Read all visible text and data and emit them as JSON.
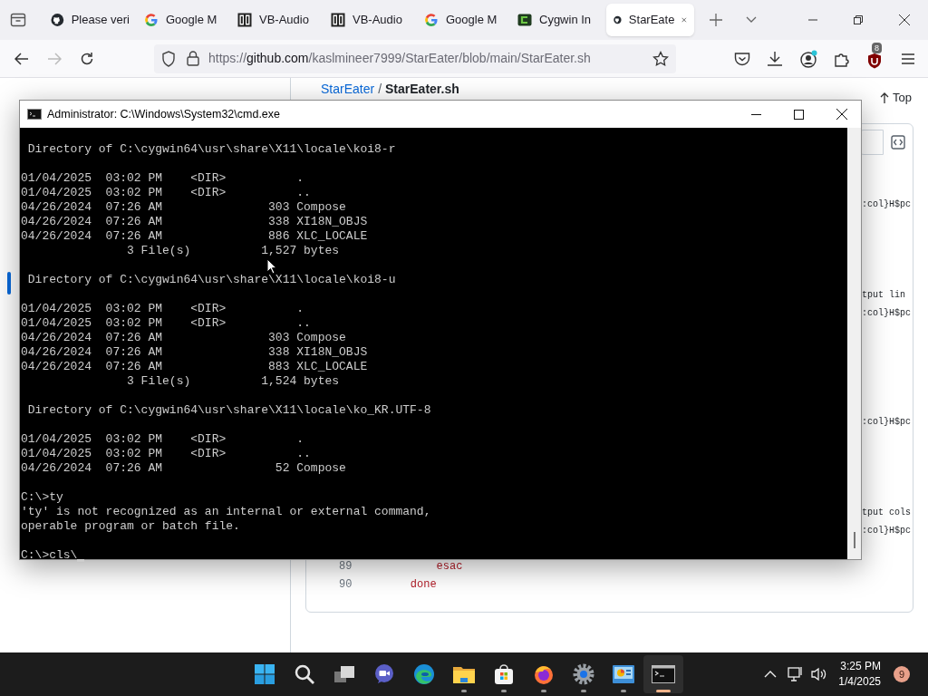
{
  "browser": {
    "tabs": [
      {
        "label": "Please veri",
        "kind": "github",
        "selected": false
      },
      {
        "label": "Google M",
        "kind": "google",
        "selected": false
      },
      {
        "label": "VB-Audio",
        "kind": "vb",
        "selected": false
      },
      {
        "label": "VB-Audio",
        "kind": "vb",
        "selected": false
      },
      {
        "label": "Google M",
        "kind": "google",
        "selected": false
      },
      {
        "label": "Cygwin In",
        "kind": "cygwin",
        "selected": false
      },
      {
        "label": "StarEate",
        "kind": "github",
        "selected": true
      }
    ],
    "url": {
      "scheme": "https://",
      "host": "github.com",
      "path": "/kaslmineer7999/StarEater/blob/main/StarEater.sh"
    },
    "extension_badge": "8",
    "breadcrumb": {
      "repo": "StarEater",
      "separator": "/",
      "file": "StarEater.sh"
    },
    "top_button": "Top",
    "code_rows": [
      {
        "kind": "fragment",
        "text": ":col}H$pc"
      },
      {
        "kind": "blank"
      },
      {
        "kind": "blank"
      },
      {
        "kind": "blank"
      },
      {
        "kind": "blank"
      },
      {
        "kind": "fragment",
        "text": "tput lin"
      },
      {
        "kind": "fragment",
        "text": ":col}H$pc"
      },
      {
        "kind": "blank"
      },
      {
        "kind": "blank"
      },
      {
        "kind": "blank"
      },
      {
        "kind": "blank"
      },
      {
        "kind": "blank"
      },
      {
        "kind": "fragment",
        "text": ":col}H$pc"
      },
      {
        "kind": "blank"
      },
      {
        "kind": "blank"
      },
      {
        "kind": "blank"
      },
      {
        "kind": "blank"
      },
      {
        "kind": "fragment",
        "text": "tput cols"
      },
      {
        "kind": "fragment",
        "text": ":col}H$pc"
      },
      {
        "kind": "blank"
      },
      {
        "kind": "line",
        "number": "89",
        "text": "        esac"
      },
      {
        "kind": "line",
        "number": "90",
        "text": "    done"
      }
    ]
  },
  "console_window": {
    "title": "Administrator: C:\\Windows\\System32\\cmd.exe",
    "lines": [
      {
        "kind": "text",
        "text": " Directory of C:\\cygwin64\\usr\\share\\X11\\locale\\koi8-r"
      },
      {
        "kind": "blank"
      },
      {
        "kind": "text",
        "text": "01/04/2025  03:02 PM    <DIR>          ."
      },
      {
        "kind": "text",
        "text": "01/04/2025  03:02 PM    <DIR>          .."
      },
      {
        "kind": "text",
        "text": "04/26/2024  07:26 AM               303 Compose"
      },
      {
        "kind": "text",
        "text": "04/26/2024  07:26 AM               338 XI18N_OBJS"
      },
      {
        "kind": "text",
        "text": "04/26/2024  07:26 AM               886 XLC_LOCALE"
      },
      {
        "kind": "text",
        "text": "               3 File(s)          1,527 bytes"
      },
      {
        "kind": "blank"
      },
      {
        "kind": "text",
        "text": " Directory of C:\\cygwin64\\usr\\share\\X11\\locale\\koi8-u"
      },
      {
        "kind": "blank"
      },
      {
        "kind": "text",
        "text": "01/04/2025  03:02 PM    <DIR>          ."
      },
      {
        "kind": "text",
        "text": "01/04/2025  03:02 PM    <DIR>          .."
      },
      {
        "kind": "text",
        "text": "04/26/2024  07:26 AM               303 Compose"
      },
      {
        "kind": "text",
        "text": "04/26/2024  07:26 AM               338 XI18N_OBJS"
      },
      {
        "kind": "text",
        "text": "04/26/2024  07:26 AM               883 XLC_LOCALE"
      },
      {
        "kind": "text",
        "text": "               3 File(s)          1,524 bytes"
      },
      {
        "kind": "blank"
      },
      {
        "kind": "text",
        "text": " Directory of C:\\cygwin64\\usr\\share\\X11\\locale\\ko_KR.UTF-8"
      },
      {
        "kind": "blank"
      },
      {
        "kind": "text",
        "text": "01/04/2025  03:02 PM    <DIR>          ."
      },
      {
        "kind": "text",
        "text": "01/04/2025  03:02 PM    <DIR>          .."
      },
      {
        "kind": "text",
        "text": "04/26/2024  07:26 AM                52 Compose"
      },
      {
        "kind": "blank"
      },
      {
        "kind": "text",
        "text": "C:\\>ty"
      },
      {
        "kind": "text",
        "text": "'ty' is not recognized as an internal or external command,"
      },
      {
        "kind": "text",
        "text": "operable program or batch file."
      },
      {
        "kind": "blank"
      },
      {
        "kind": "prompt",
        "text": "C:\\>cls\\"
      }
    ]
  },
  "taskbar": {
    "apps": [
      {
        "kind": "start",
        "selected": false
      },
      {
        "kind": "search",
        "selected": false
      },
      {
        "kind": "taskview",
        "selected": false
      },
      {
        "kind": "meet",
        "selected": false
      },
      {
        "kind": "edge",
        "selected": false
      },
      {
        "kind": "explorer",
        "selected": false
      },
      {
        "kind": "store",
        "selected": false
      },
      {
        "kind": "firefox",
        "selected": false
      },
      {
        "kind": "settings",
        "selected": false
      },
      {
        "kind": "control",
        "selected": false
      },
      {
        "kind": "terminal",
        "selected": true
      }
    ],
    "time": "3:25 PM",
    "date": "1/4/2025",
    "notification_count": "9"
  }
}
